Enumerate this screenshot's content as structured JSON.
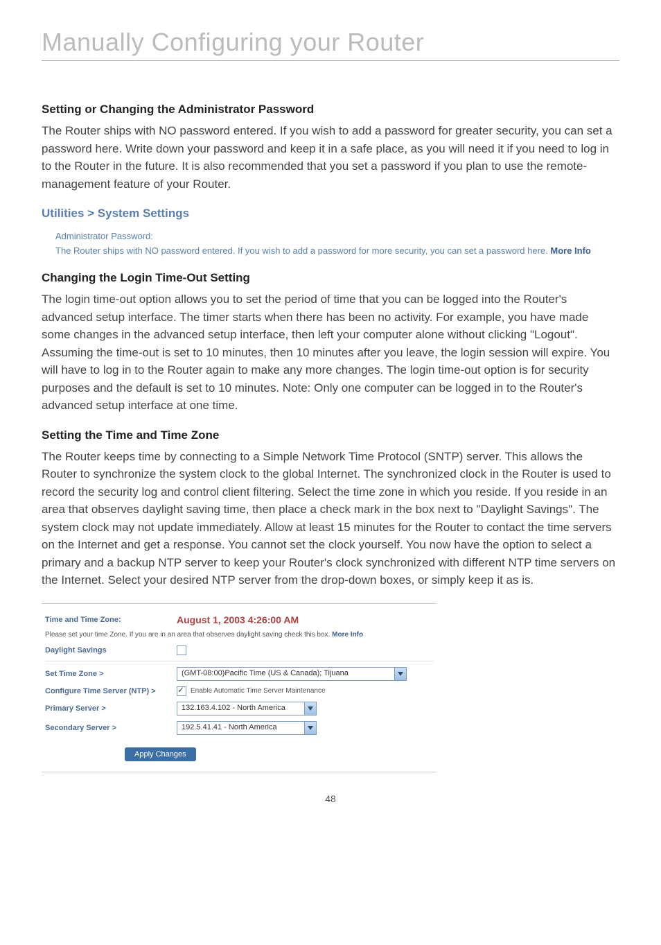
{
  "page": {
    "main_title": "Manually Configuring your Router",
    "page_number": "48"
  },
  "sections": {
    "admin_pw": {
      "heading": "Setting or Changing the Administrator Password",
      "body": "The Router ships with NO password entered. If you wish to add a password for greater security, you can set a password here. Write down your password and keep it in a safe place, as you will need it if you need to log in to the Router in the future. It is also recommended that you set a password if you plan to use the remote-management feature of your Router."
    },
    "ui_block1": {
      "title": "Utilities > System Settings",
      "label": "Administrator Password:",
      "text": "The Router ships with NO password entered. If you wish to add a password for more security, you can set a password here. ",
      "more": "More Info"
    },
    "login_timeout": {
      "heading": "Changing the Login Time-Out Setting",
      "body": "The login time-out option allows you to set the period of time that you can be logged into the Router's advanced setup interface. The timer starts when there has been no activity. For example, you have made some changes in the advanced setup interface, then left your computer alone without clicking \"Logout\". Assuming the time-out is set to 10 minutes, then 10 minutes after you leave, the login session will expire. You will have to log in to the Router again to make any more changes. The login time-out option is for security purposes and the default is set to 10 minutes. Note: Only one computer can be logged in to the Router's advanced setup interface at one time."
    },
    "time_zone": {
      "heading": "Setting the Time and Time Zone",
      "body": "The Router keeps time by connecting to a Simple Network Time Protocol (SNTP) server. This allows the Router to synchronize the system clock to the global Internet. The synchronized clock in the Router is used to record the security log and control client filtering. Select the time zone in which you reside. If you reside in an area that observes daylight saving time, then place a check mark in the box next to \"Daylight Savings\". The system clock may not update immediately. Allow at least 15 minutes for the Router to contact the time servers on the Internet and get a response. You cannot set the clock yourself. You now have the option to select a primary and a backup NTP server to keep your Router's clock synchronized with different NTP time servers on the Internet. Select your desired NTP server from the drop-down boxes, or simply keep it as is."
    }
  },
  "panel": {
    "time_label": "Time and Time Zone:",
    "time_value": "August 1, 2003 4:26:00 AM",
    "desc_prefix": "Please set your time Zone. If you are in an area that observes daylight saving check this box. ",
    "desc_more": "More Info",
    "daylight_label": "Daylight Savings",
    "settz_label": "Set Time Zone >",
    "tz_value": "(GMT-08:00)Pacific Time (US & Canada); Tijuana",
    "ntp_label": "Configure Time Server (NTP) >",
    "ntp_checkbox_label": "Enable Automatic Time Server Maintenance",
    "primary_label": "Primary Server >",
    "primary_value": "132.163.4.102 - North America",
    "secondary_label": "Secondary Server >",
    "secondary_value": "192.5.41.41 - North America",
    "apply_btn": "Apply Changes"
  }
}
